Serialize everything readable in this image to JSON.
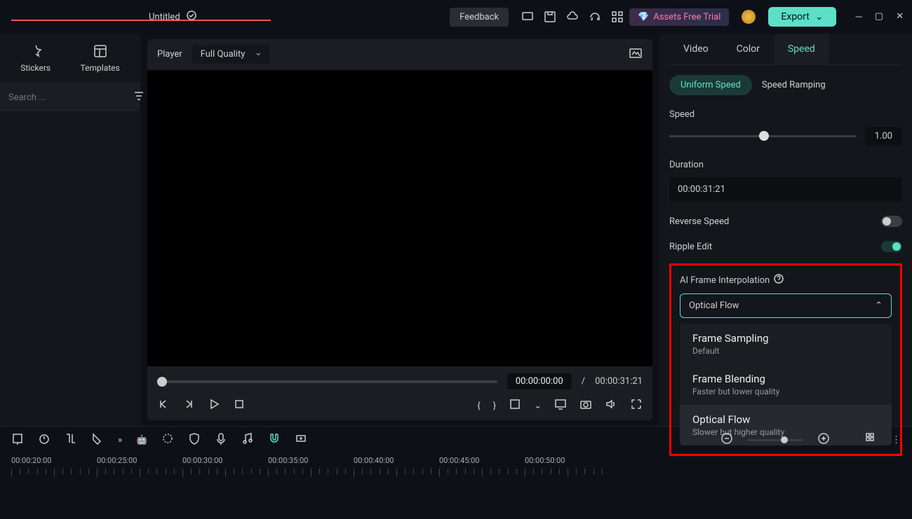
{
  "topbar": {
    "title": "Untitled",
    "feedback": "Feedback",
    "assets_trial": "Assets Free Trial",
    "export": "Export"
  },
  "left_panel": {
    "tabs": [
      {
        "label": "Stickers"
      },
      {
        "label": "Templates"
      }
    ],
    "search_placeholder": "Search ..."
  },
  "player": {
    "label": "Player",
    "quality": "Full Quality",
    "time_current": "00:00:00:00",
    "time_separator": "/",
    "time_total": "00:00:31:21"
  },
  "right_panel": {
    "tabs": [
      "Video",
      "Color",
      "Speed"
    ],
    "active_tab": 2,
    "sub_tabs": [
      "Uniform Speed",
      "Speed Ramping"
    ],
    "speed": {
      "label": "Speed",
      "value": "1.00"
    },
    "duration": {
      "label": "Duration",
      "value": "00:00:31:21"
    },
    "reverse_label": "Reverse Speed",
    "ripple_label": "Ripple Edit",
    "interpolation": {
      "label": "AI Frame Interpolation",
      "selected": "Optical Flow",
      "options": [
        {
          "title": "Frame Sampling",
          "sub": "Default"
        },
        {
          "title": "Frame Blending",
          "sub": "Faster but lower quality"
        },
        {
          "title": "Optical Flow",
          "sub": "Slower but higher quality"
        }
      ]
    }
  },
  "timeline": {
    "ticks": [
      "00:00:20:00",
      "00:00:25:00",
      "00:00:30:00",
      "00:00:35:00",
      "00:00:40:00",
      "00:00:45:00",
      "00:00:50:00"
    ]
  }
}
